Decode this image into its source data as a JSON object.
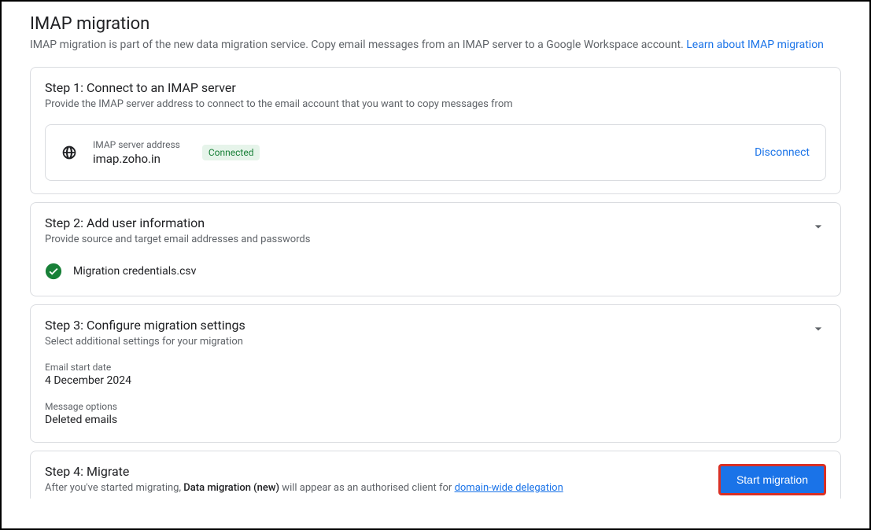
{
  "header": {
    "title": "IMAP migration",
    "subtitle": "IMAP migration is part of the new data migration service. Copy email messages from an IMAP server to a Google Workspace account. ",
    "learn_link": "Learn about IMAP migration"
  },
  "step1": {
    "title": "Step 1: Connect to an IMAP server",
    "desc": "Provide the IMAP server address to connect to the email account that you want to copy messages from",
    "server_label": "IMAP server address",
    "server_value": "imap.zoho.in",
    "status": "Connected",
    "disconnect": "Disconnect"
  },
  "step2": {
    "title": "Step 2: Add user information",
    "desc": "Provide source and target email addresses and passwords",
    "file_name": "Migration credentials.csv"
  },
  "step3": {
    "title": "Step 3: Configure migration settings",
    "desc": "Select additional settings for your migration",
    "date_label": "Email start date",
    "date_value": "4 December 2024",
    "options_label": "Message options",
    "options_value": "Deleted emails"
  },
  "step4": {
    "title": "Step 4: Migrate",
    "desc_pre": "After you've started migrating, ",
    "desc_bold": "Data migration (new)",
    "desc_post": " will appear as an authorised client for ",
    "link": "domain-wide delegation",
    "button": "Start migration"
  }
}
